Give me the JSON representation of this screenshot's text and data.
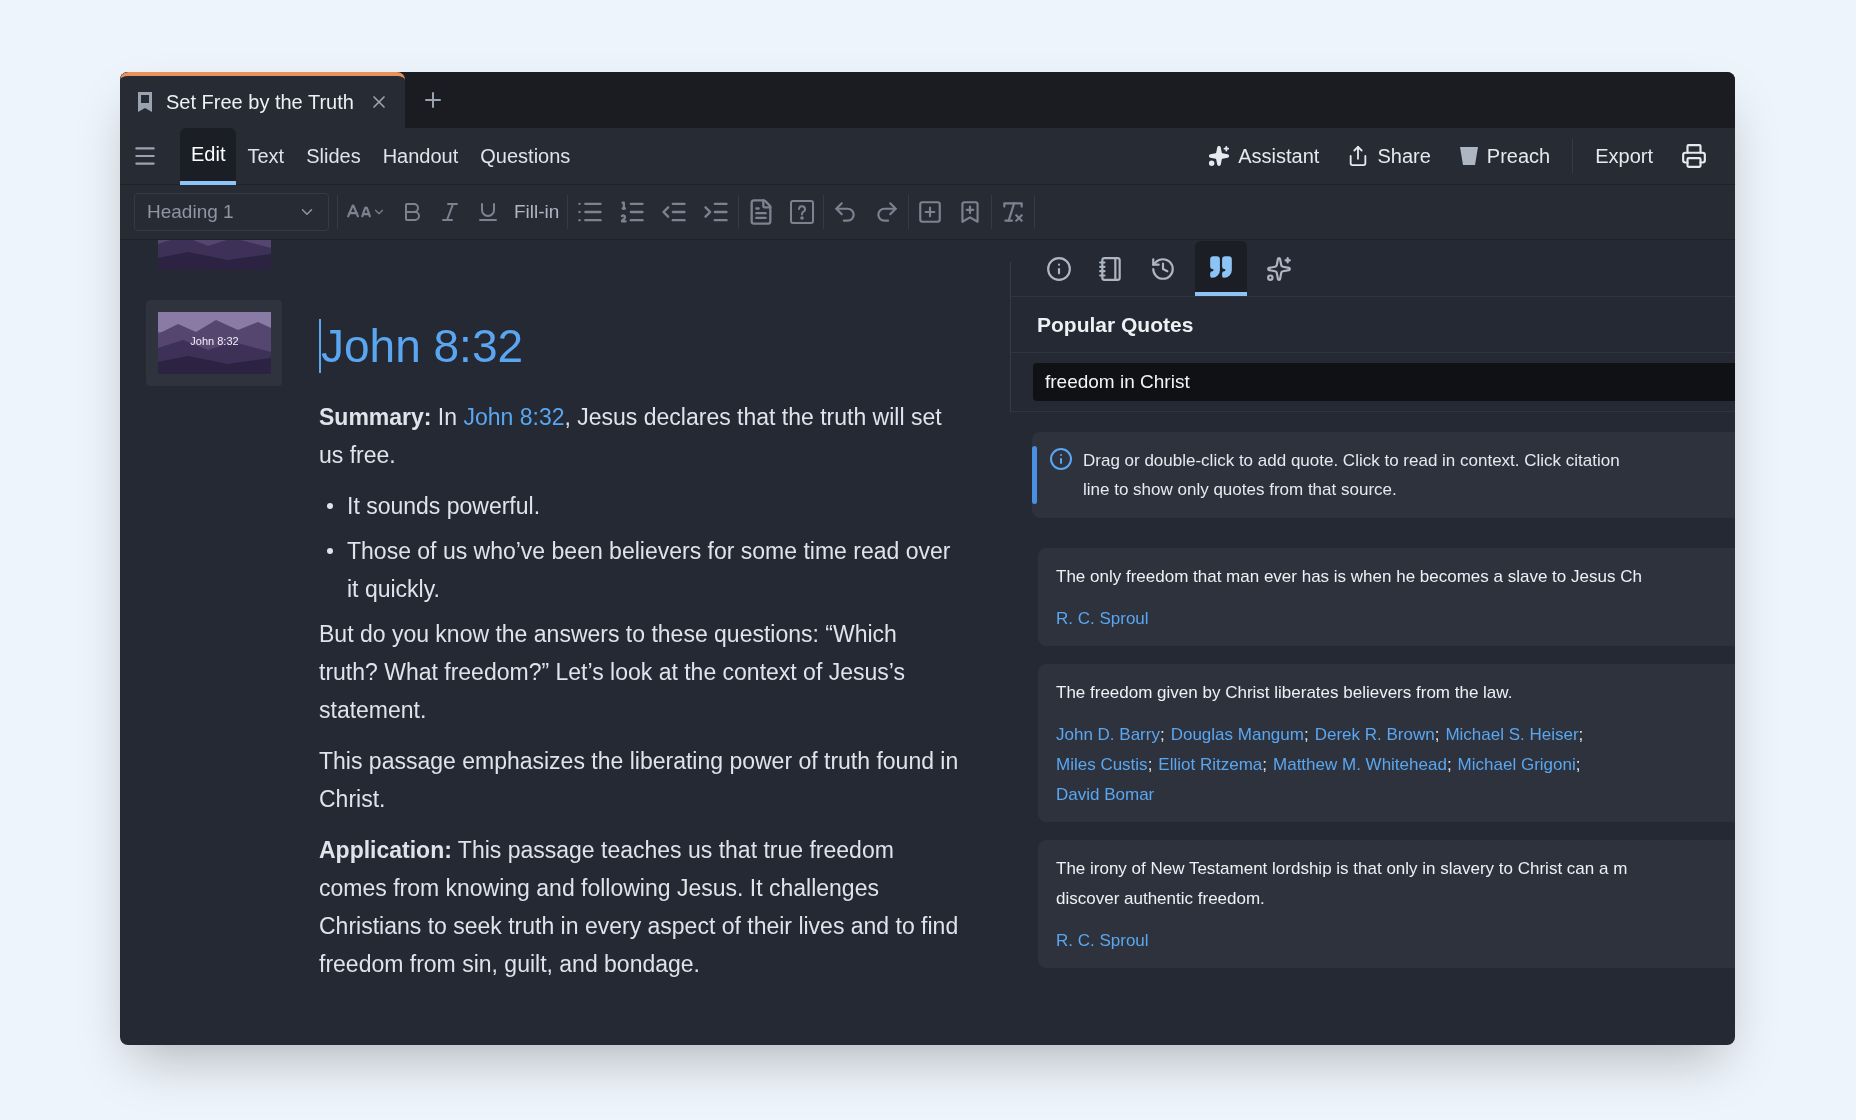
{
  "doc_tabs": [
    {
      "title": "Set Free by the Truth",
      "selected": true
    }
  ],
  "menu_tabs": [
    {
      "label": "Edit",
      "selected": true
    },
    {
      "label": "Text",
      "selected": false
    },
    {
      "label": "Slides",
      "selected": false
    },
    {
      "label": "Handout",
      "selected": false
    },
    {
      "label": "Questions",
      "selected": false
    }
  ],
  "actions": [
    {
      "kind": "assistant",
      "label": "Assistant"
    },
    {
      "kind": "share",
      "label": "Share"
    },
    {
      "kind": "preach",
      "label": "Preach"
    },
    {
      "kind": "export",
      "label": "Export"
    },
    {
      "kind": "print"
    }
  ],
  "toolbar": {
    "style_select": "Heading 1",
    "fill_in": "Fill-in"
  },
  "slides": [
    {
      "selected": false
    },
    {
      "label": "John 8:32",
      "selected": true
    }
  ],
  "editor": [
    {
      "kind": "heading",
      "parts": [
        {
          "text": "John 8:32"
        }
      ]
    },
    {
      "kind": "paragraph",
      "parts": [
        {
          "text": "Summary:",
          "bold": true
        },
        {
          "text": " In "
        },
        {
          "text": "John 8:32",
          "link": true
        },
        {
          "text": ", Jesus declares that the truth will set us free."
        }
      ]
    },
    {
      "kind": "bullet",
      "parts": [
        {
          "text": "It sounds powerful."
        }
      ]
    },
    {
      "kind": "bullet",
      "parts": [
        {
          "text": "Those of us who’ve been believers for some time read over it quickly."
        }
      ]
    },
    {
      "kind": "paragraph",
      "parts": [
        {
          "text": "But do you know the answers to these questions: “Which truth? What freedom?” Let’s look at the context of Jesus’s statement."
        }
      ]
    },
    {
      "kind": "paragraph",
      "parts": [
        {
          "text": "This passage emphasizes the liberating power of truth found in Christ."
        }
      ]
    },
    {
      "kind": "paragraph",
      "parts": [
        {
          "text": "Application:",
          "bold": true
        },
        {
          "text": " This passage teaches us that true freedom comes from knowing and following Jesus. It challenges Christians to seek truth in every aspect of their lives and to find freedom from sin, guilt, and bondage."
        }
      ]
    }
  ],
  "panel_tabs": [
    {
      "kind": "info",
      "selected": false
    },
    {
      "kind": "notebook",
      "selected": false
    },
    {
      "kind": "history",
      "selected": false
    },
    {
      "kind": "quotes",
      "selected": true
    },
    {
      "kind": "assistant",
      "selected": false
    }
  ],
  "panel": {
    "title": "Popular Quotes",
    "search": "freedom in Christ",
    "info_lines": [
      "Drag or double-click to add quote. Click to read in context. Click citation",
      "line to show only quotes from that source."
    ]
  },
  "quotes": [
    {
      "lines": [
        "The only freedom that man ever has is when he becomes a slave to Jesus Ch"
      ],
      "authors": [
        {
          "name": "R. C. Sproul"
        }
      ]
    },
    {
      "lines": [
        "The freedom given by Christ liberates believers from the law."
      ],
      "authors": [
        {
          "name": "John D. Barry",
          "suffix": ";"
        },
        {
          "name": "Douglas Mangum",
          "suffix": ";"
        },
        {
          "name": "Derek R. Brown",
          "suffix": ";"
        },
        {
          "name": "Michael S. Heiser",
          "suffix": ";"
        },
        {
          "name": "Miles Custis",
          "suffix": ";"
        },
        {
          "name": "Elliot Ritzema",
          "suffix": ";"
        },
        {
          "name": "Matthew M. Whitehead",
          "suffix": ";"
        },
        {
          "name": "Michael Grigoni",
          "suffix": ";"
        },
        {
          "name": "David Bomar"
        }
      ]
    },
    {
      "lines": [
        "The irony of New Testament lordship is that only in slavery to Christ can a m",
        "discover authentic freedom."
      ],
      "authors": [
        {
          "name": "R. C. Sproul"
        }
      ]
    }
  ]
}
